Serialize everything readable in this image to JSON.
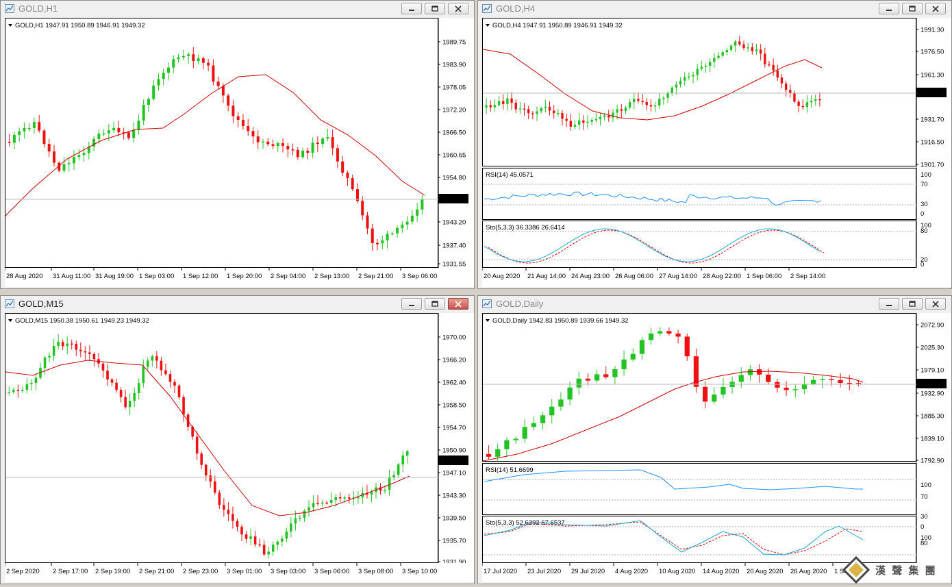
{
  "windows": [
    {
      "id": "h1",
      "title": "GOLD,H1",
      "active": false,
      "close_highlight": false,
      "header_text": "GOLD,H1  1947.91 1950.89 1946.91 1949.32",
      "price_ticks": [
        "1989.75",
        "1983.90",
        "1978.05",
        "1972.20",
        "1966.50",
        "1960.65",
        "1954.80",
        "1949.32",
        "1943.20",
        "1937.40",
        "1931.55"
      ],
      "current_price": "1949.32",
      "time_labels": [
        "28 Aug 2020",
        "31 Aug 11:00",
        "31 Aug 19:00",
        "1 Sep 03:00",
        "1 Sep 12:00",
        "1 Sep 20:00",
        "2 Sep 04:00",
        "2 Sep 13:00",
        "2 Sep 21:00",
        "3 Sep 06:00"
      ],
      "has_indicators": false
    },
    {
      "id": "h4",
      "title": "GOLD,H4",
      "active": false,
      "close_highlight": false,
      "header_text": "GOLD,H4  1947.91 1950.89 1946.91 1949.32",
      "price_ticks": [
        "1991.30",
        "1976.50",
        "1961.30",
        "1949.32",
        "1931.70",
        "1916.50",
        "1901.70"
      ],
      "current_price": "1949.32",
      "time_labels": [
        "20 Aug 2020",
        "21 Aug 14:00",
        "24 Aug 23:00",
        "26 Aug 06:00",
        "27 Aug 14:00",
        "28 Aug 22:00",
        "1 Sep 06:00",
        "2 Sep 14:00"
      ],
      "has_indicators": true,
      "rsi_label": "RSI(14) 45.0571",
      "rsi_ticks": [
        "100",
        "70",
        "30",
        "0"
      ],
      "sto_label": "Sto(5,3,3) 36.3386 26.6414",
      "sto_ticks": [
        "100",
        "80",
        "20",
        "0"
      ]
    },
    {
      "id": "m15",
      "title": "GOLD,M15",
      "active": true,
      "close_highlight": true,
      "header_text": "GOLD,M15  1950.38 1950.61 1949.23 1949.32",
      "price_ticks": [
        "1970.00",
        "1966.20",
        "1962.40",
        "1958.50",
        "1954.70",
        "1950.90",
        "1949.32",
        "1947.10",
        "1943.30",
        "1939.50",
        "1935.70",
        "1931.90"
      ],
      "current_price": "1949.32",
      "time_labels": [
        "2 Sep 2020",
        "2 Sep 17:00",
        "2 Sep 19:00",
        "2 Sep 21:00",
        "2 Sep 23:00",
        "3 Sep 01:00",
        "3 Sep 03:00",
        "3 Sep 06:00",
        "3 Sep 08:00",
        "3 Sep 10:00"
      ],
      "has_indicators": false
    },
    {
      "id": "daily",
      "title": "GOLD,Daily",
      "active": false,
      "close_highlight": false,
      "header_text": "GOLD,Daily  1942.83 1950.89 1939.66 1949.32",
      "price_ticks": [
        "2072.90",
        "2025.30",
        "1979.10",
        "1949.32",
        "1932.90",
        "1885.30",
        "1839.10",
        "1792.90"
      ],
      "current_price": "1949.32",
      "time_labels": [
        "17 Jul 2020",
        "23 Jul 2020",
        "29 Jul 2020",
        "4 Aug 2020",
        "10 Aug 2020",
        "14 Aug 2020",
        "20 Aug 2020",
        "26 Aug 2020",
        "1 Sep"
      ],
      "has_indicators": true,
      "rsi_label": "RSI(14) 51.6699",
      "rsi_ticks": [
        "100",
        "70",
        "30",
        "0"
      ],
      "sto_label": "Sto(5,3,3) 52.6292 67.6537",
      "sto_ticks": [
        "100",
        "80",
        "20"
      ]
    }
  ],
  "watermark": {
    "text": "漢 聲 集 團"
  },
  "colors": {
    "bull": "#22c322",
    "bear": "#ee1111",
    "ma": "#cc0000",
    "rsi": "#1e90ff",
    "sto_main": "#1aa7d8",
    "sto_signal": "#dd0000"
  }
}
